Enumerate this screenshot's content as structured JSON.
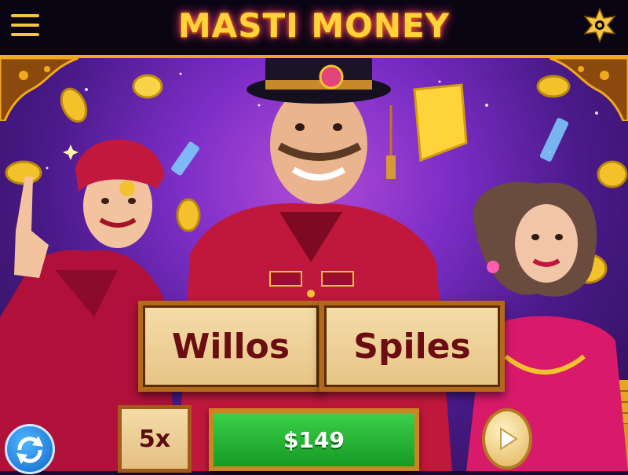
{
  "header": {
    "title": "MASTI MONEY",
    "menu_icon": "hamburger-menu-icon",
    "settings_icon": "star-gear-icon"
  },
  "actions": {
    "willos_label": "Willos",
    "spiles_label": "Spiles",
    "multiplier_label": "5x",
    "amount_label": "$149"
  },
  "controls": {
    "refresh_icon": "refresh-arrows-icon",
    "play_icon": "play-triangle-icon"
  },
  "colors": {
    "title_gold": "#ffd33a",
    "frame_gold": "#f2a81d",
    "button_beige": "#f4dca8",
    "button_text": "#6b0d12",
    "amount_green": "#1fa82f",
    "background_purple": "#7d2ec7"
  }
}
